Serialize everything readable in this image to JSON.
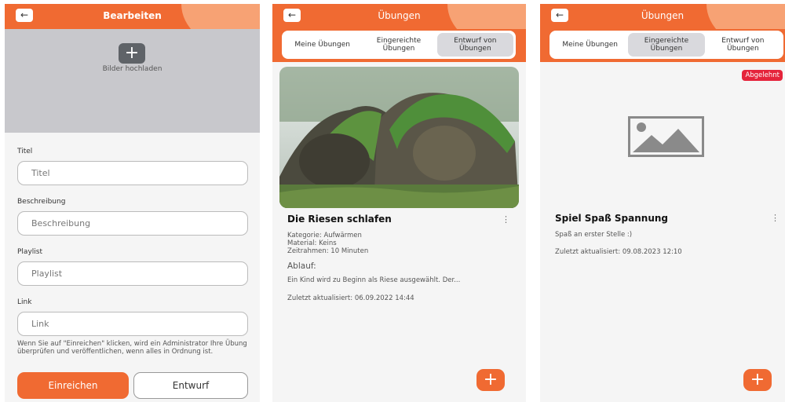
{
  "screen_edit": {
    "title": "Bearbeiten",
    "back_icon": "←",
    "upload_label": "Bilder hochladen",
    "fields": [
      {
        "label": "Titel",
        "placeholder": "Titel"
      },
      {
        "label": "Beschreibung",
        "placeholder": "Beschreibung"
      },
      {
        "label": "Playlist",
        "placeholder": "Playlist"
      },
      {
        "label": "Link",
        "placeholder": "Link"
      }
    ],
    "note": "Wenn Sie auf \"Einreichen\" klicken, wird ein Administrator Ihre Übung überprüfen und veröffentlichen, wenn alles in Ordnung ist.",
    "submit_label": "Einreichen",
    "draft_label": "Entwurf"
  },
  "screen_drafts": {
    "title": "Übungen",
    "back_icon": "←",
    "tabs": [
      "Meine Übungen",
      "Eingereichte Übungen",
      "Entwurf von Übungen"
    ],
    "active_tab": 2,
    "card": {
      "title": "Die Riesen schlafen",
      "category": "Kategorie: Aufwärmen",
      "material": "Material: Keins",
      "timeframe": "Zeitrahmen: 10 Minuten",
      "section": "Ablauf:",
      "excerpt": "Ein Kind wird zu Beginn als Riese ausgewählt. Der...",
      "updated": "Zuletzt aktualisiert: 06.09.2022 14:44"
    },
    "fab": "+"
  },
  "screen_submitted": {
    "title": "Übungen",
    "back_icon": "←",
    "tabs": [
      "Meine Übungen",
      "Eingereichte Übungen",
      "Entwurf von Übungen"
    ],
    "active_tab": 1,
    "badge": "Abgelehnt",
    "card": {
      "title": "Spiel Spaß Spannung",
      "subtitle": "Spaß an erster Stelle :)",
      "updated": "Zuletzt aktualisiert: 09.08.2023 12:10"
    },
    "fab": "+"
  },
  "colors": {
    "accent": "#f06a32",
    "accent_light": "#f7a274",
    "danger": "#e5243b"
  }
}
